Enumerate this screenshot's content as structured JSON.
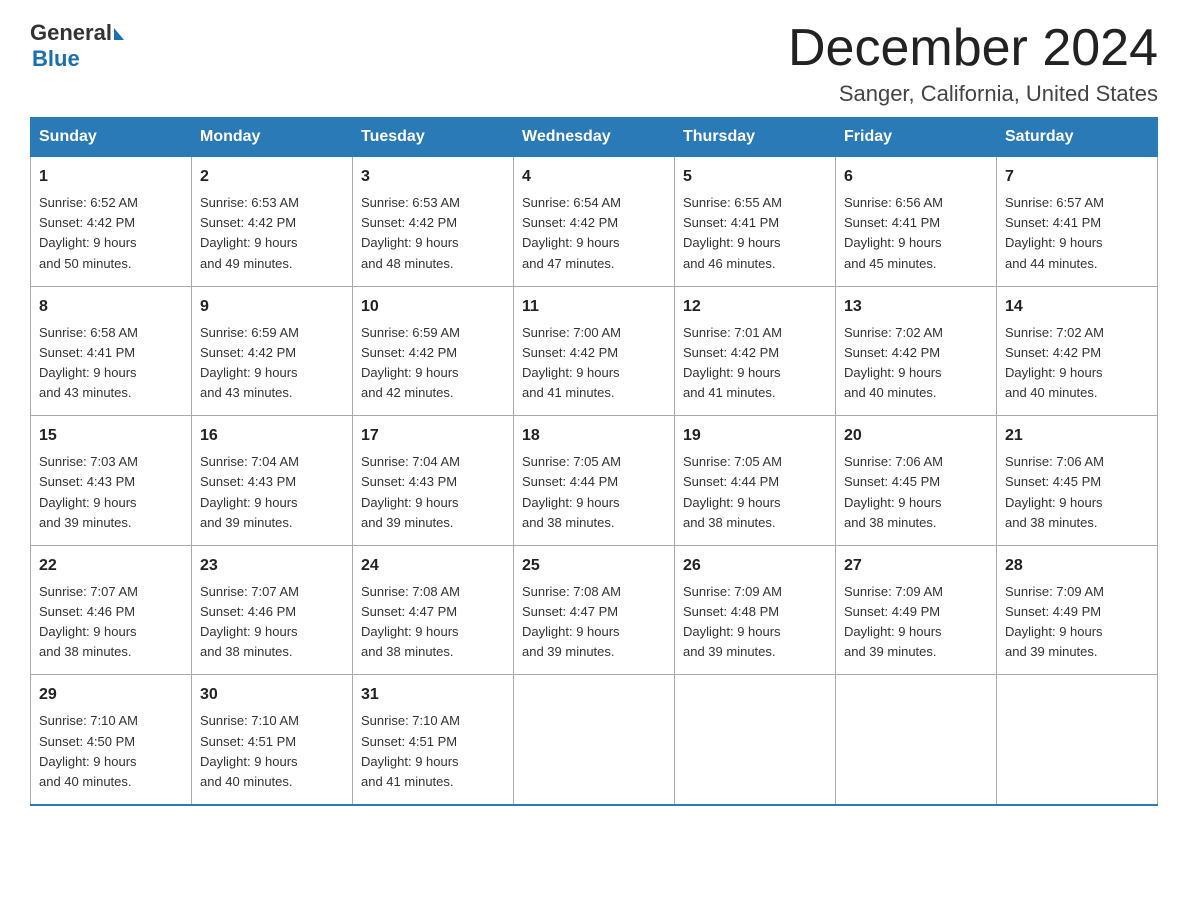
{
  "header": {
    "logo_general": "General",
    "logo_blue": "Blue",
    "month_title": "December 2024",
    "location": "Sanger, California, United States"
  },
  "days_of_week": [
    "Sunday",
    "Monday",
    "Tuesday",
    "Wednesday",
    "Thursday",
    "Friday",
    "Saturday"
  ],
  "weeks": [
    [
      {
        "day": "1",
        "sunrise": "6:52 AM",
        "sunset": "4:42 PM",
        "daylight": "9 hours and 50 minutes."
      },
      {
        "day": "2",
        "sunrise": "6:53 AM",
        "sunset": "4:42 PM",
        "daylight": "9 hours and 49 minutes."
      },
      {
        "day": "3",
        "sunrise": "6:53 AM",
        "sunset": "4:42 PM",
        "daylight": "9 hours and 48 minutes."
      },
      {
        "day": "4",
        "sunrise": "6:54 AM",
        "sunset": "4:42 PM",
        "daylight": "9 hours and 47 minutes."
      },
      {
        "day": "5",
        "sunrise": "6:55 AM",
        "sunset": "4:41 PM",
        "daylight": "9 hours and 46 minutes."
      },
      {
        "day": "6",
        "sunrise": "6:56 AM",
        "sunset": "4:41 PM",
        "daylight": "9 hours and 45 minutes."
      },
      {
        "day": "7",
        "sunrise": "6:57 AM",
        "sunset": "4:41 PM",
        "daylight": "9 hours and 44 minutes."
      }
    ],
    [
      {
        "day": "8",
        "sunrise": "6:58 AM",
        "sunset": "4:41 PM",
        "daylight": "9 hours and 43 minutes."
      },
      {
        "day": "9",
        "sunrise": "6:59 AM",
        "sunset": "4:42 PM",
        "daylight": "9 hours and 43 minutes."
      },
      {
        "day": "10",
        "sunrise": "6:59 AM",
        "sunset": "4:42 PM",
        "daylight": "9 hours and 42 minutes."
      },
      {
        "day": "11",
        "sunrise": "7:00 AM",
        "sunset": "4:42 PM",
        "daylight": "9 hours and 41 minutes."
      },
      {
        "day": "12",
        "sunrise": "7:01 AM",
        "sunset": "4:42 PM",
        "daylight": "9 hours and 41 minutes."
      },
      {
        "day": "13",
        "sunrise": "7:02 AM",
        "sunset": "4:42 PM",
        "daylight": "9 hours and 40 minutes."
      },
      {
        "day": "14",
        "sunrise": "7:02 AM",
        "sunset": "4:42 PM",
        "daylight": "9 hours and 40 minutes."
      }
    ],
    [
      {
        "day": "15",
        "sunrise": "7:03 AM",
        "sunset": "4:43 PM",
        "daylight": "9 hours and 39 minutes."
      },
      {
        "day": "16",
        "sunrise": "7:04 AM",
        "sunset": "4:43 PM",
        "daylight": "9 hours and 39 minutes."
      },
      {
        "day": "17",
        "sunrise": "7:04 AM",
        "sunset": "4:43 PM",
        "daylight": "9 hours and 39 minutes."
      },
      {
        "day": "18",
        "sunrise": "7:05 AM",
        "sunset": "4:44 PM",
        "daylight": "9 hours and 38 minutes."
      },
      {
        "day": "19",
        "sunrise": "7:05 AM",
        "sunset": "4:44 PM",
        "daylight": "9 hours and 38 minutes."
      },
      {
        "day": "20",
        "sunrise": "7:06 AM",
        "sunset": "4:45 PM",
        "daylight": "9 hours and 38 minutes."
      },
      {
        "day": "21",
        "sunrise": "7:06 AM",
        "sunset": "4:45 PM",
        "daylight": "9 hours and 38 minutes."
      }
    ],
    [
      {
        "day": "22",
        "sunrise": "7:07 AM",
        "sunset": "4:46 PM",
        "daylight": "9 hours and 38 minutes."
      },
      {
        "day": "23",
        "sunrise": "7:07 AM",
        "sunset": "4:46 PM",
        "daylight": "9 hours and 38 minutes."
      },
      {
        "day": "24",
        "sunrise": "7:08 AM",
        "sunset": "4:47 PM",
        "daylight": "9 hours and 38 minutes."
      },
      {
        "day": "25",
        "sunrise": "7:08 AM",
        "sunset": "4:47 PM",
        "daylight": "9 hours and 39 minutes."
      },
      {
        "day": "26",
        "sunrise": "7:09 AM",
        "sunset": "4:48 PM",
        "daylight": "9 hours and 39 minutes."
      },
      {
        "day": "27",
        "sunrise": "7:09 AM",
        "sunset": "4:49 PM",
        "daylight": "9 hours and 39 minutes."
      },
      {
        "day": "28",
        "sunrise": "7:09 AM",
        "sunset": "4:49 PM",
        "daylight": "9 hours and 39 minutes."
      }
    ],
    [
      {
        "day": "29",
        "sunrise": "7:10 AM",
        "sunset": "4:50 PM",
        "daylight": "9 hours and 40 minutes."
      },
      {
        "day": "30",
        "sunrise": "7:10 AM",
        "sunset": "4:51 PM",
        "daylight": "9 hours and 40 minutes."
      },
      {
        "day": "31",
        "sunrise": "7:10 AM",
        "sunset": "4:51 PM",
        "daylight": "9 hours and 41 minutes."
      },
      null,
      null,
      null,
      null
    ]
  ],
  "labels": {
    "sunrise": "Sunrise:",
    "sunset": "Sunset:",
    "daylight": "Daylight:"
  }
}
